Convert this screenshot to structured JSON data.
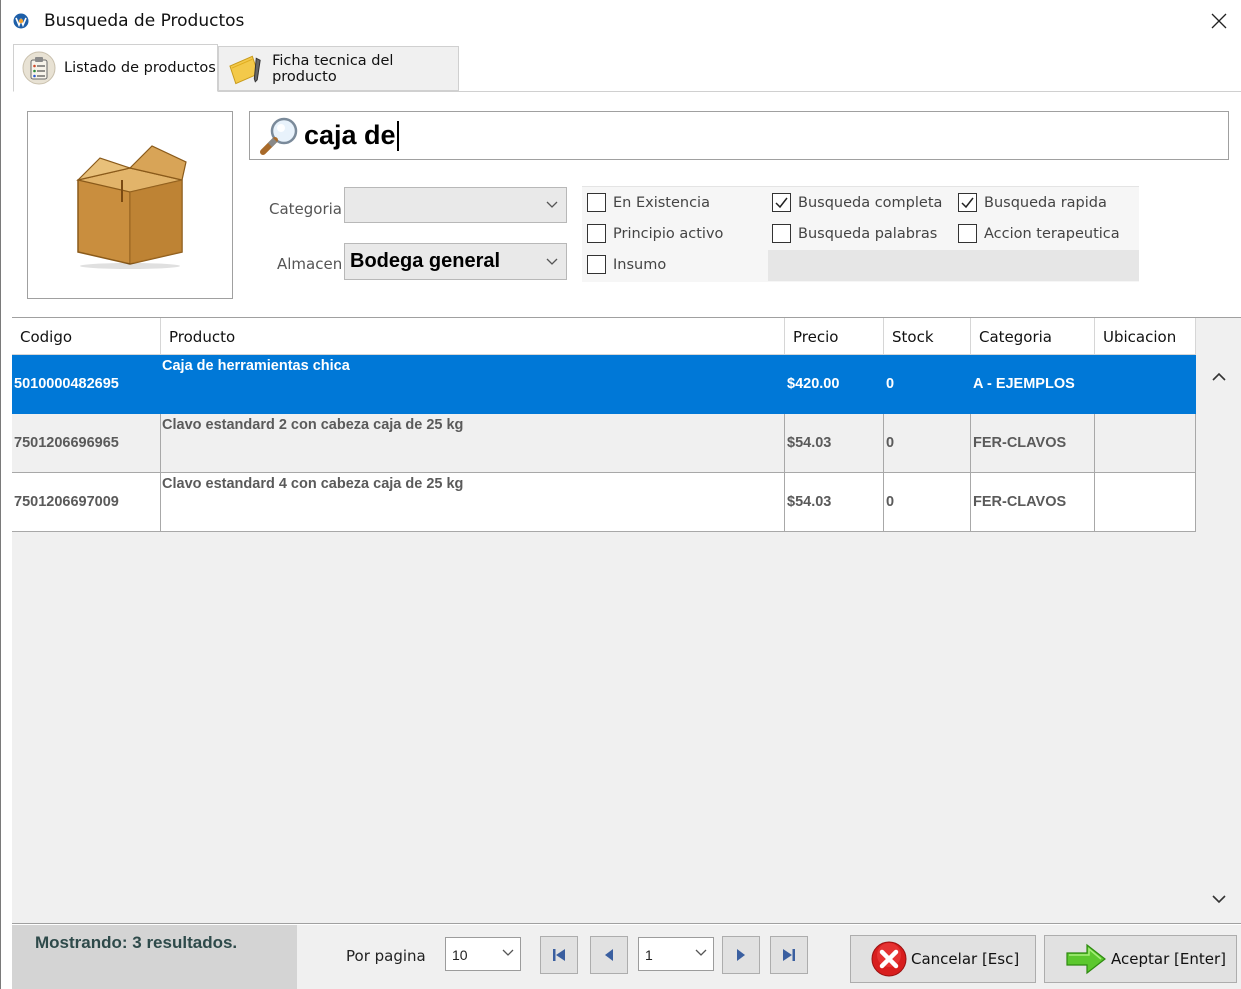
{
  "window": {
    "title": "Busqueda de Productos"
  },
  "tabs": [
    {
      "label": "Listado de productos",
      "active": true
    },
    {
      "label": "Ficha tecnica del producto",
      "active": false
    }
  ],
  "search": {
    "value": "caja de"
  },
  "filters": {
    "categoria_label": "Categoria",
    "categoria_value": "",
    "almacen_label": "Almacen",
    "almacen_value": "Bodega general"
  },
  "options": [
    {
      "label": "En Existencia",
      "checked": false
    },
    {
      "label": "Principio activo",
      "checked": false
    },
    {
      "label": "Insumo",
      "checked": false
    },
    {
      "label": "Busqueda completa",
      "checked": true
    },
    {
      "label": "Busqueda palabras",
      "checked": false
    },
    {
      "label": "Busqueda rapida",
      "checked": true
    },
    {
      "label": "Accion terapeutica",
      "checked": false
    }
  ],
  "table": {
    "columns": [
      "Codigo",
      "Producto",
      "Precio",
      "Stock",
      "Categoria",
      "Ubicacion"
    ],
    "rows": [
      {
        "codigo": "5010000482695",
        "producto": "Caja de herramientas chica",
        "precio": "$420.00",
        "stock": "0",
        "categoria": "A - EJEMPLOS",
        "ubicacion": "",
        "selected": true
      },
      {
        "codigo": "7501206696965",
        "producto": "Clavo estandard  2   con cabeza  caja de 25 kg",
        "precio": "$54.03",
        "stock": "0",
        "categoria": "FER-CLAVOS",
        "ubicacion": "",
        "selected": false
      },
      {
        "codigo": "7501206697009",
        "producto": "Clavo estandard  4   con cabeza  caja de 25 kg",
        "precio": "$54.03",
        "stock": "0",
        "categoria": "FER-CLAVOS",
        "ubicacion": "",
        "selected": false
      }
    ]
  },
  "footer": {
    "status": "Mostrando: 3 resultados.",
    "per_page_label": "Por pagina",
    "per_page_value": "10",
    "page_value": "1",
    "cancel_label": "Cancelar [Esc]",
    "accept_label": "Aceptar [Enter]"
  },
  "colors": {
    "selection": "#0078d7",
    "status_bg": "#d4d4d4",
    "status_text": "#2e4a4a"
  }
}
